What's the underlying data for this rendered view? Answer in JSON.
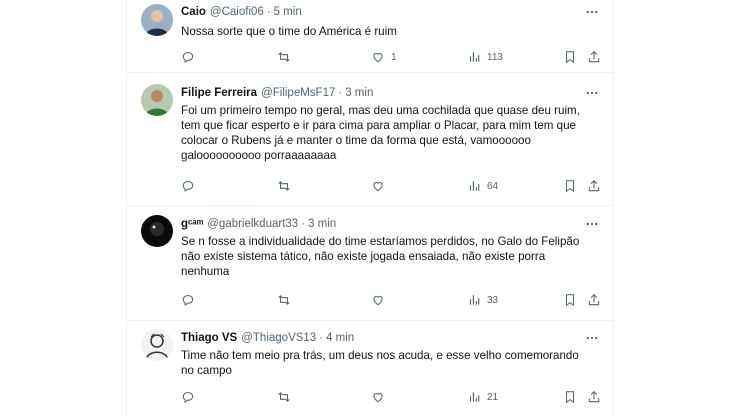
{
  "tweets": [
    {
      "name": "Caio",
      "handle": "@Caiofi06",
      "sep": "·",
      "time": "5 min",
      "text": "Nossa sorte que o time do América é ruim",
      "replies": "",
      "retweets": "",
      "likes": "1",
      "views": "113",
      "avatar_icon": "person-photo-icon"
    },
    {
      "name": "Filipe Ferreira",
      "handle": "@FilipeMsF17",
      "sep": "·",
      "time": "3 min",
      "text": "Foi um primeiro tempo no geral, mas deu uma cochilada que quase deu ruim,\ntem que ficar esperto e ir para cima para ampliar o Placar, para mim tem que\ncolocar o Rubens já e manter o time da forma que está, vamoooooo\ngaloooooooooo porraaaaaaaa",
      "replies": "",
      "retweets": "",
      "likes": "",
      "views": "64",
      "avatar_icon": "person-photo-icon"
    },
    {
      "name": "gᶜᵃᵐ",
      "handle": "@gabrielkduart33",
      "sep": "·",
      "time": "3 min",
      "text": "Se n fosse a individualidade do time estaríamos perdidos, no Galo do Felipão\nnão existe sistema tático, não existe jogada ensaiada, não existe porra\nnenhuma",
      "replies": "",
      "retweets": "",
      "likes": "",
      "views": "33",
      "avatar_icon": "dark-avatar-icon"
    },
    {
      "name": "Thiago VS",
      "handle": "@ThiagoVS13",
      "sep": "·",
      "time": "4 min",
      "text": "Time não tem meio pra trás, um deus nos acuda, e esse velho comemorando\nno campo",
      "replies": "",
      "retweets": "",
      "likes": "",
      "views": "21",
      "avatar_icon": "sketch-avatar-icon"
    }
  ],
  "colors": {
    "text": "#0f1419",
    "secondary": "#536471",
    "border": "#eff3f4"
  }
}
